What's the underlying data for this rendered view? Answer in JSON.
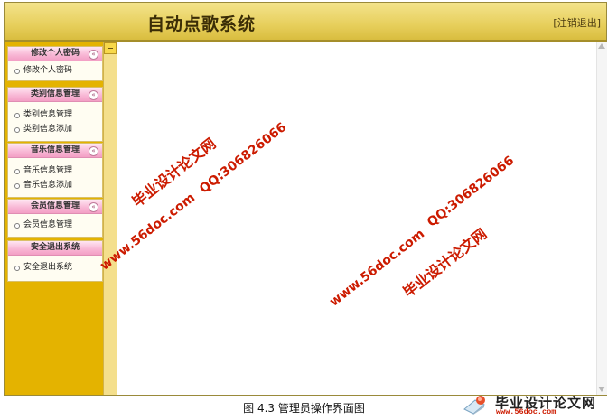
{
  "header": {
    "title": "自动点歌系统",
    "logout": "[注销退出]"
  },
  "sidebar": {
    "groups": [
      {
        "title": "修改个人密码",
        "items": [
          "修改个人密码"
        ]
      },
      {
        "title": "类别信息管理",
        "items": [
          "类别信息管理",
          "类别信息添加"
        ]
      },
      {
        "title": "音乐信息管理",
        "items": [
          "音乐信息管理",
          "音乐信息添加"
        ]
      },
      {
        "title": "会员信息管理",
        "items": [
          "会员信息管理"
        ]
      },
      {
        "title": "安全退出系统",
        "items": [
          "安全退出系统"
        ]
      }
    ],
    "collapse_symbol": "«",
    "toggle_icon": "minus-icon"
  },
  "caption": "图 4.3  管理员操作界面图",
  "watermarks": {
    "site_name": "毕业设计论文网",
    "url": "www.56doc.com",
    "qq": "QQ:306826066"
  },
  "logo": {
    "title": "毕业设计论文网",
    "url": "www.56doc.com"
  },
  "colors": {
    "header": "#e7cf5c",
    "sidebar": "#e4b300",
    "menu_head": "#f8b6d4",
    "watermark": "#cc1b00"
  }
}
